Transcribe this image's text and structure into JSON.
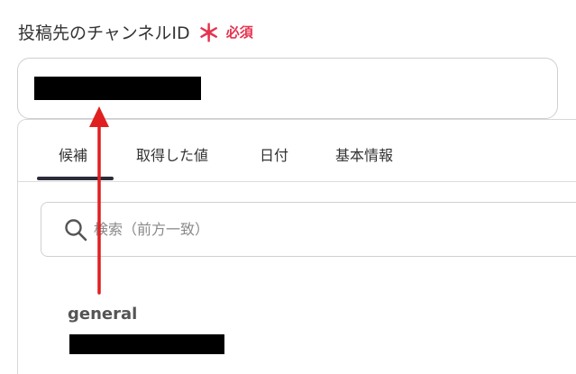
{
  "field": {
    "label": "投稿先のチャンネルID",
    "required_mark": "＊",
    "required_text": "必須",
    "value": ""
  },
  "dropdown": {
    "tabs": [
      {
        "label": "候補",
        "active": true
      },
      {
        "label": "取得した値",
        "active": false
      },
      {
        "label": "日付",
        "active": false
      },
      {
        "label": "基本情報",
        "active": false
      }
    ],
    "search": {
      "placeholder": "検索（前方一致）",
      "icon": "search-icon"
    },
    "options": [
      {
        "name": "general",
        "id": ""
      }
    ]
  },
  "colors": {
    "required": "#e5334e",
    "annotation_arrow": "#e02020",
    "tab_indicator": "#2b2b3a"
  }
}
